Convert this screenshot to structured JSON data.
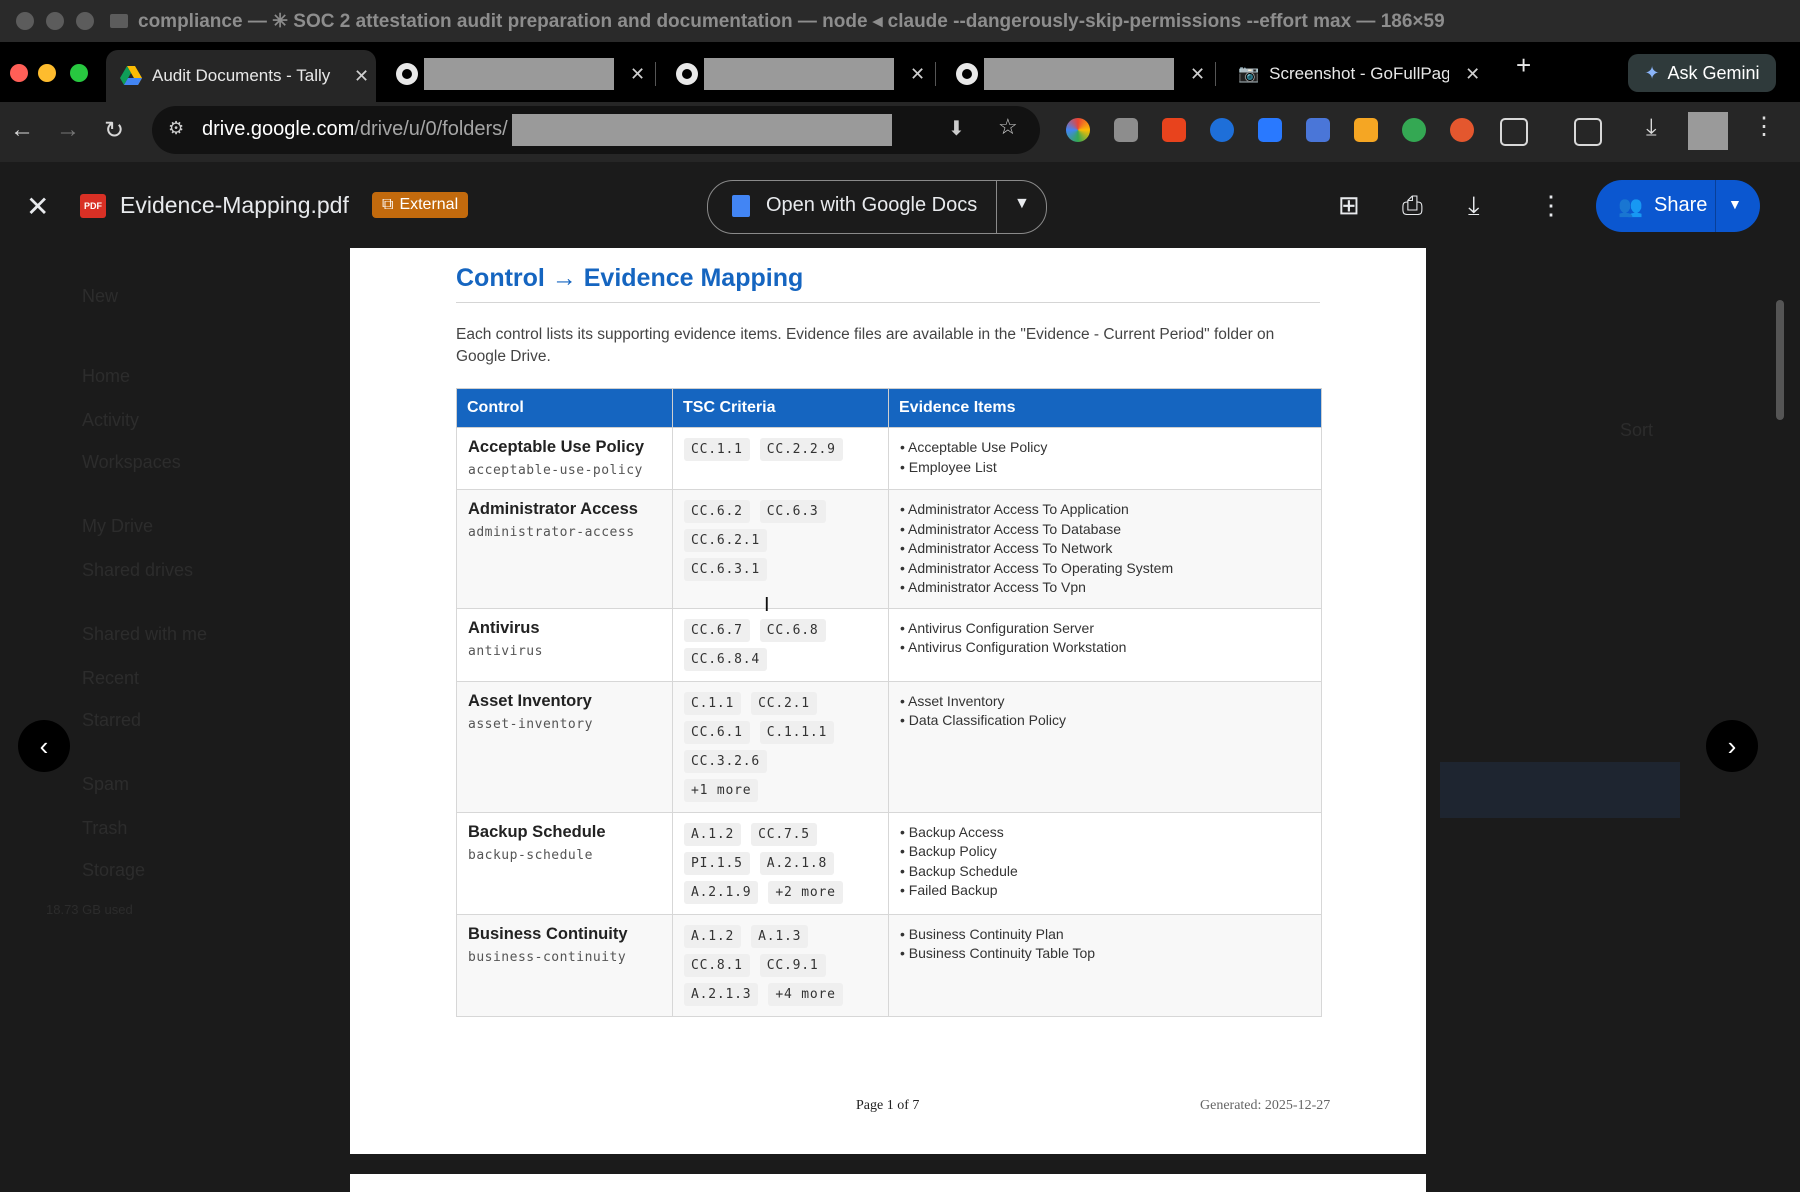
{
  "terminal": {
    "title": "compliance — ✳ SOC 2 attestation audit preparation and documentation — node ◂ claude --dangerously-skip-permissions --effort max — 186×59"
  },
  "tabs": [
    {
      "label": "Audit Documents - Tally",
      "icon": "google-drive-icon",
      "active": true
    },
    {
      "label": "",
      "icon": "github-icon"
    },
    {
      "label": "",
      "icon": "github-icon"
    },
    {
      "label": "",
      "icon": "github-icon"
    },
    {
      "label": "Screenshot - GoFullPag",
      "icon": "camera-icon"
    }
  ],
  "browser": {
    "ask_gemini": "Ask Gemini",
    "url_domain": "drive.google.com",
    "url_path": "/drive/u/0/folders/",
    "new_tab": "+"
  },
  "drive_bg": {
    "new_label": "New",
    "nav": [
      "Home",
      "Activity",
      "Workspaces",
      "My Drive",
      "Shared drives",
      "Shared with me",
      "Recent",
      "Starred",
      "Spam",
      "Trash",
      "Storage"
    ],
    "storage_used": "18.73 GB used",
    "sort_label": "Sort"
  },
  "viewer": {
    "file_name": "Evidence-Mapping.pdf",
    "pdf_badge": "PDF",
    "external_badge": "External",
    "open_with": "Open with Google Docs",
    "share": "Share"
  },
  "document": {
    "title": "Control → Evidence Mapping",
    "intro": "Each control lists its supporting evidence items. Evidence files are available in the \"Evidence - Current Period\" folder on Google Drive.",
    "columns": [
      "Control",
      "TSC Criteria",
      "Evidence Items"
    ],
    "rows": [
      {
        "name": "Acceptable Use Policy",
        "id": "acceptable-use-policy",
        "criteria": [
          "CC.1.1",
          "CC.2.2.9"
        ],
        "evidence": [
          "Acceptable Use Policy",
          "Employee List"
        ]
      },
      {
        "name": "Administrator Access",
        "id": "administrator-access",
        "criteria": [
          "CC.6.2",
          "CC.6.3",
          "CC.6.2.1",
          "CC.6.3.1"
        ],
        "evidence": [
          "Administrator Access To Application",
          "Administrator Access To Database",
          "Administrator Access To Network",
          "Administrator Access To Operating System",
          "Administrator Access To Vpn"
        ]
      },
      {
        "name": "Antivirus",
        "id": "antivirus",
        "criteria": [
          "CC.6.7",
          "CC.6.8",
          "CC.6.8.4"
        ],
        "evidence": [
          "Antivirus Configuration Server",
          "Antivirus Configuration Workstation"
        ]
      },
      {
        "name": "Asset Inventory",
        "id": "asset-inventory",
        "criteria": [
          "C.1.1",
          "CC.2.1",
          "CC.6.1",
          "C.1.1.1",
          "CC.3.2.6",
          "+1 more"
        ],
        "evidence": [
          "Asset Inventory",
          "Data Classification Policy"
        ]
      },
      {
        "name": "Backup Schedule",
        "id": "backup-schedule",
        "criteria": [
          "A.1.2",
          "CC.7.5",
          "PI.1.5",
          "A.2.1.8",
          "A.2.1.9",
          "+2 more"
        ],
        "evidence": [
          "Backup Access",
          "Backup Policy",
          "Backup Schedule",
          "Failed Backup"
        ]
      },
      {
        "name": "Business Continuity",
        "id": "business-continuity",
        "criteria": [
          "A.1.2",
          "A.1.3",
          "CC.8.1",
          "CC.9.1",
          "A.2.1.3",
          "+4 more"
        ],
        "evidence": [
          "Business Continuity Plan",
          "Business Continuity Table Top"
        ]
      }
    ],
    "page_label": "Page 1 of 7",
    "generated": "Generated: 2025-12-27"
  },
  "colors": {
    "accent": "#1565c0",
    "share": "#0b57d0",
    "external": "#c26a0d"
  }
}
